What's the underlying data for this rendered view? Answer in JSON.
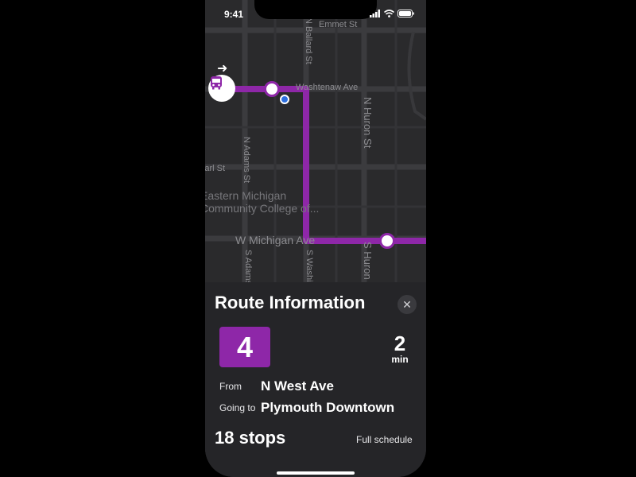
{
  "status": {
    "time": "9:41"
  },
  "map": {
    "streets": {
      "emmet": "Emmet St",
      "washtenaw": "Washtenaw Ave",
      "n_huron": "N Huron St",
      "n_adams": "N Adams St",
      "earl": "Earl St",
      "w_michigan": "W Michigan Ave",
      "s_adams": "S Adams",
      "s_washington": "S Washington",
      "s_huron": "S Huron",
      "top_vert": "N Ballard St"
    },
    "poi": {
      "line1": "Eastern Michigan",
      "line2": "Community College of..."
    },
    "route_color": "#8e27a8"
  },
  "sheet": {
    "title": "Route Information",
    "route_number": "4",
    "eta_value": "2",
    "eta_unit": "min",
    "from_label": "From",
    "from_value": "N West Ave",
    "going_label": "Going to",
    "going_value": "Plymouth Downtown",
    "stops": "18 stops",
    "schedule_link": "Full schedule"
  },
  "icons": [
    "signal-icon",
    "wifi-icon",
    "battery-icon",
    "bus-icon",
    "arrow-right-icon",
    "close-icon"
  ]
}
